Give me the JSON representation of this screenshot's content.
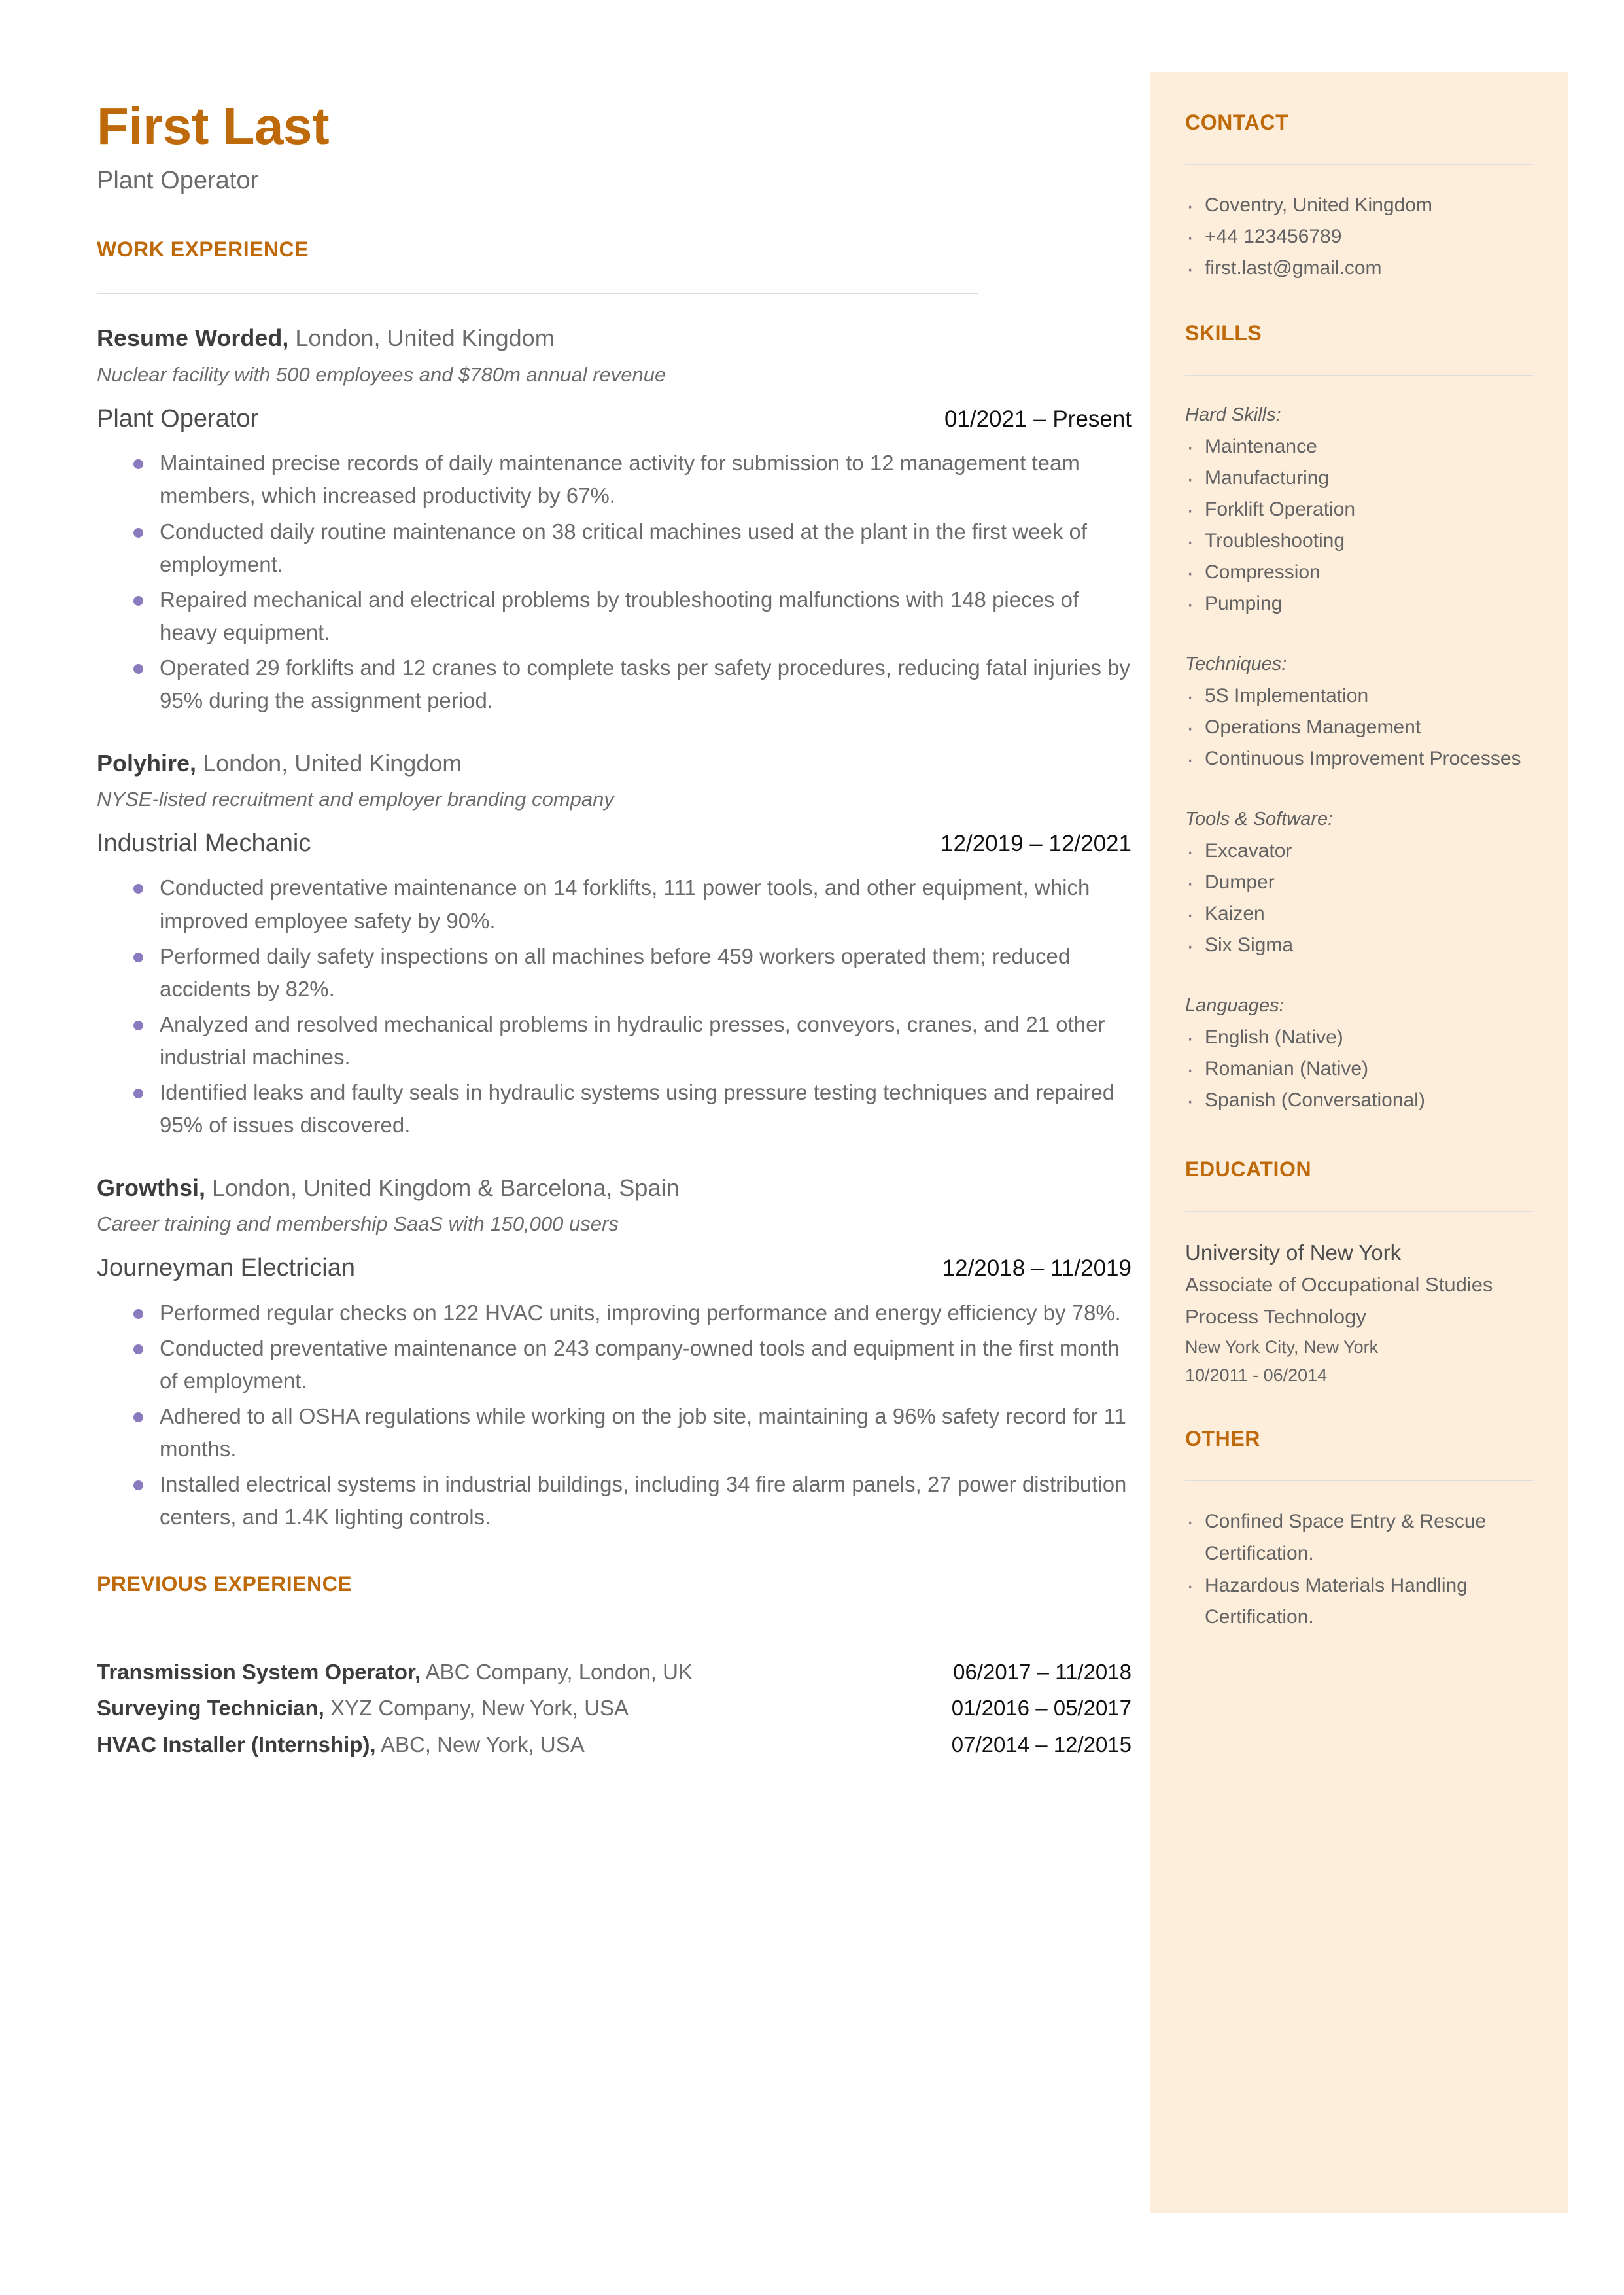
{
  "header": {
    "name": "First Last",
    "role": "Plant Operator"
  },
  "main": {
    "work_experience_heading": "WORK EXPERIENCE",
    "previous_experience_heading": "PREVIOUS EXPERIENCE",
    "jobs": [
      {
        "company": "Resume Worded,",
        "location": " London, United Kingdom",
        "description": "Nuclear facility with 500 employees and $780m annual revenue",
        "title": "Plant Operator",
        "dates": "01/2021 – Present",
        "bullets": [
          "Maintained precise records of daily maintenance activity for submission to 12 management team members, which increased productivity by 67%.",
          "Conducted daily routine maintenance on 38 critical machines used at the plant in the first week of employment.",
          "Repaired mechanical and electrical problems by troubleshooting malfunctions with 148 pieces of heavy equipment.",
          "Operated 29 forklifts and 12 cranes to complete tasks per safety procedures, reducing fatal injuries by 95% during the assignment period."
        ]
      },
      {
        "company": "Polyhire,",
        "location": " London, United Kingdom",
        "description": "NYSE-listed recruitment and employer branding company",
        "title": "Industrial Mechanic",
        "dates": "12/2019 – 12/2021",
        "bullets": [
          "Conducted preventative maintenance on 14 forklifts, 111 power tools, and other equipment, which improved employee safety by 90%.",
          "Performed daily safety inspections on all machines before 459 workers operated them; reduced accidents by 82%.",
          "Analyzed and resolved mechanical problems in hydraulic presses, conveyors, cranes, and 21 other industrial machines.",
          "Identified leaks and faulty seals in hydraulic systems using pressure testing techniques and repaired 95% of issues discovered."
        ]
      },
      {
        "company": "Growthsi,",
        "location": " London, United Kingdom & Barcelona, Spain",
        "description": "Career training and membership SaaS with 150,000 users",
        "title": "Journeyman Electrician",
        "dates": "12/2018 – 11/2019",
        "bullets": [
          "Performed regular checks on 122 HVAC units,  improving performance and energy efficiency by 78%.",
          "Conducted preventative maintenance on 243 company-owned tools and equipment in the first month of employment.",
          "Adhered to all OSHA regulations while working on the job site, maintaining a 96% safety record for 11 months.",
          "Installed electrical systems in industrial buildings, including 34 fire alarm panels, 27 power distribution centers, and 1.4K lighting controls."
        ]
      }
    ],
    "previous": [
      {
        "title": "Transmission System Operator,",
        "detail": " ABC Company, London, UK",
        "dates": "06/2017 – 11/2018"
      },
      {
        "title": "Surveying Technician,",
        "detail": " XYZ Company, New York, USA",
        "dates": "01/2016 – 05/2017"
      },
      {
        "title": "HVAC Installer (Internship),",
        "detail": " ABC, New York, USA",
        "dates": "07/2014 – 12/2015"
      }
    ]
  },
  "sidebar": {
    "contact_heading": "CONTACT",
    "contact_items": [
      "Coventry, United Kingdom",
      "+44 123456789",
      "first.last@gmail.com"
    ],
    "skills_heading": "SKILLS",
    "skill_groups": [
      {
        "label": "Hard Skills:",
        "items": [
          "Maintenance",
          "Manufacturing",
          "Forklift Operation",
          "Troubleshooting",
          "Compression",
          "Pumping"
        ]
      },
      {
        "label": "Techniques:",
        "items": [
          "5S Implementation",
          "Operations Management",
          "Continuous Improvement Processes"
        ]
      },
      {
        "label": "Tools & Software:",
        "items": [
          "Excavator",
          "Dumper",
          "Kaizen",
          "Six Sigma"
        ]
      },
      {
        "label": "Languages:",
        "items": [
          "English (Native)",
          "Romanian (Native)",
          "Spanish (Conversational)"
        ]
      }
    ],
    "education_heading": "EDUCATION",
    "education": {
      "school": "University of New York",
      "degree": "Associate of Occupational Studies",
      "field": "Process Technology",
      "location": "New York City, New York",
      "dates": "10/2011 - 06/2014"
    },
    "other_heading": "OTHER",
    "other_items": [
      "Confined Space Entry & Rescue Certification.",
      "Hazardous Materials Handling Certification."
    ]
  },
  "colors": {
    "accent": "#BF6A0A",
    "sidebar_bg": "#FDEEDC",
    "bullet": "#8A7BBF",
    "body_text": "#6B6B6B",
    "rule": "#DCDCDC"
  }
}
